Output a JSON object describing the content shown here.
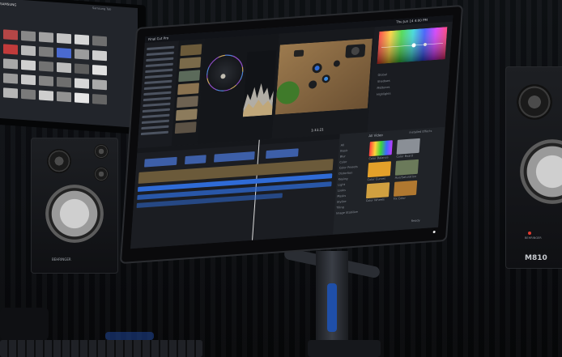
{
  "left_monitor": {
    "brand_label": "SAMSUNG",
    "corner_label": "Samsung Tab"
  },
  "editor": {
    "title_left": "Final Cut Pro",
    "title_right": "Thu Jun 14 4:00 PM",
    "timecode": "1:11:21",
    "effects_header": "All Video",
    "effects_tab": "Installed Effects",
    "inspector_rows": [
      "Global",
      "Shadows",
      "Midtones",
      "Highlights"
    ],
    "effects_categories": [
      "All",
      "Basic",
      "Blur",
      "Color",
      "Color Presets",
      "Distortion",
      "Keying",
      "Light",
      "Looks",
      "Masks",
      "Stylize",
      "Tiling",
      "Image Stabilize"
    ],
    "effects_items": [
      "Color Balance",
      "Color Board",
      "Color Curves",
      "Hue/Saturation",
      "Color Wheels",
      "Fix Color"
    ],
    "status_text": "Ready"
  },
  "right_speaker": {
    "model_label": "M810",
    "brand_label": "BEHRINGER"
  },
  "left_speaker": {
    "brand_label": "BEHRINGER"
  },
  "colors": {
    "ui_dark": "#1e2127",
    "accent_blue": "#2f6bd6",
    "wood": "#8a6a44"
  }
}
